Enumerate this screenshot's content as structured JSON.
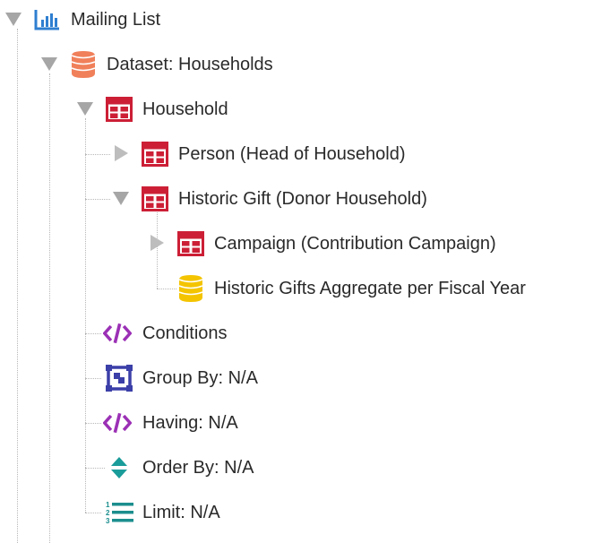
{
  "tree": {
    "root": {
      "label": "Mailing List",
      "icon": "bar-chart-icon",
      "expanded": true
    },
    "dataset": {
      "label": "Dataset: Households",
      "icon": "database-icon",
      "expanded": true
    },
    "household": {
      "label": "Household",
      "icon": "table-icon",
      "expanded": true
    },
    "person": {
      "label": "Person (Head of Household)",
      "icon": "table-icon",
      "expanded": false
    },
    "historic_gift": {
      "label": "Historic Gift (Donor Household)",
      "icon": "table-icon",
      "expanded": true
    },
    "campaign": {
      "label": "Campaign (Contribution Campaign)",
      "icon": "table-icon",
      "expanded": false
    },
    "aggregate": {
      "label": "Historic Gifts Aggregate per Fiscal Year",
      "icon": "aggregate-database-icon"
    },
    "conditions": {
      "label": "Conditions",
      "icon": "code-icon"
    },
    "group_by": {
      "label": "Group By: N/A",
      "icon": "group-by-icon"
    },
    "having": {
      "label": "Having: N/A",
      "icon": "code-icon"
    },
    "order_by": {
      "label": "Order By: N/A",
      "icon": "sort-icon"
    },
    "limit": {
      "label": "Limit: N/A",
      "icon": "numbered-list-icon"
    }
  },
  "colors": {
    "chart_blue": "#2f7fd0",
    "database_orange": "#f0805a",
    "table_red": "#cc1f36",
    "aggregate_yellow": "#f4c400",
    "code_purple": "#9b30b5",
    "group_navy": "#3b3fa8",
    "sort_teal": "#1a9c9a",
    "list_teal": "#1c8e8e",
    "toggle_gray": "#a6a6a6",
    "connector_gray": "#b8b8b8"
  }
}
